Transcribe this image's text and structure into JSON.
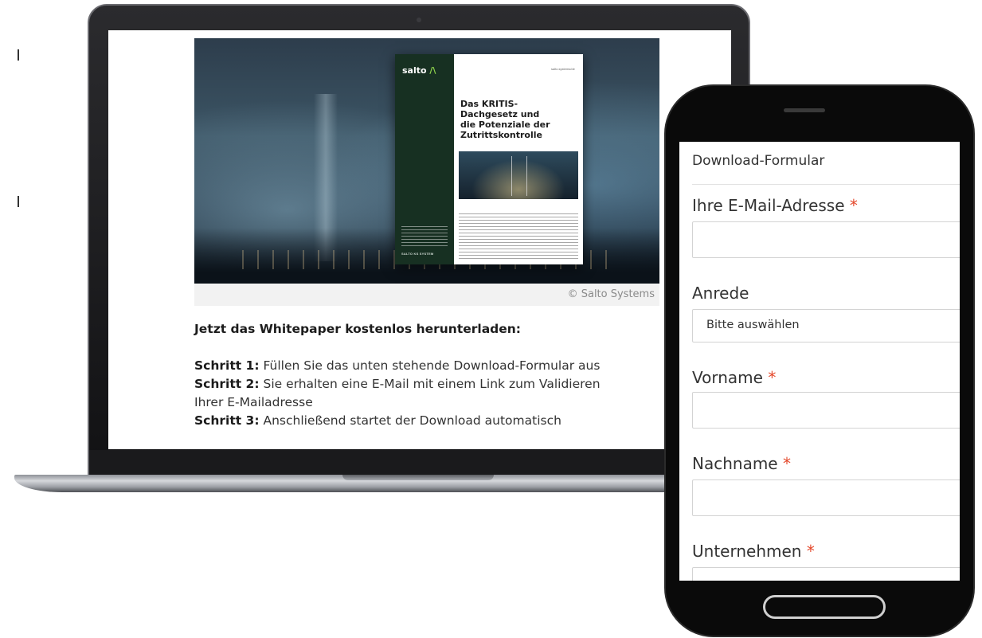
{
  "laptop": {
    "brochure": {
      "logo": "salto",
      "url": "salto.systems/de",
      "title": "Das KRITIS-\nDachgesetz und\ndie Potenziale der\nZutrittskontrolle",
      "side_brand": "SALTO KS SYSTEM"
    },
    "caption": "© Salto Systems",
    "intro": "Jetzt das Whitepaper kostenlos herunterladen:",
    "steps": [
      {
        "label": "Schritt 1:",
        "text": " Füllen Sie das unten stehende Download-Formular aus"
      },
      {
        "label": "Schritt 2:",
        "text": " Sie erhalten eine E-Mail mit einem Link zum Validieren"
      },
      {
        "label": "",
        "text": "Ihrer E-Mailadresse"
      },
      {
        "label": "Schritt 3:",
        "text": " Anschließend startet der Download automatisch"
      }
    ]
  },
  "phone": {
    "form_title": "Download-Formular",
    "fields": {
      "email": {
        "label": "Ihre E-Mail-Adresse",
        "required_mark": "*"
      },
      "salutation": {
        "label": "Anrede",
        "selected": "Bitte auswählen"
      },
      "firstname": {
        "label": "Vorname",
        "required_mark": "*"
      },
      "lastname": {
        "label": "Nachname",
        "required_mark": "*"
      },
      "company": {
        "label": "Unternehmen",
        "required_mark": "*"
      }
    }
  },
  "colors": {
    "required": "#e4472a",
    "brochure_side": "#173022"
  }
}
